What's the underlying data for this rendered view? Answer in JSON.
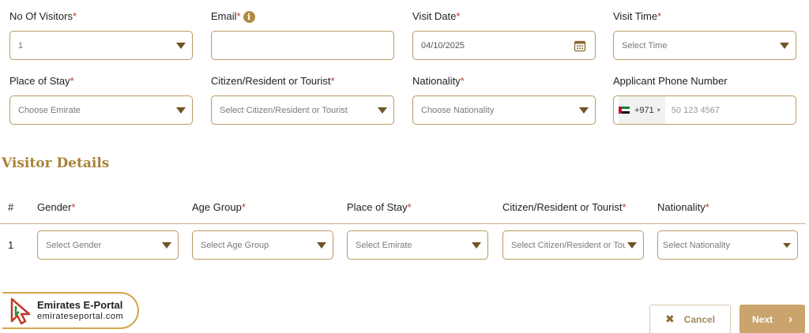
{
  "form": {
    "row1": [
      {
        "label": "No Of Visitors",
        "value": "1",
        "placeholder": ""
      },
      {
        "label": "Email",
        "value": "",
        "placeholder": ""
      },
      {
        "label": "Visit Date",
        "value": "04/10/2025",
        "placeholder": ""
      },
      {
        "label": "Visit Time",
        "value": "",
        "placeholder": "Select Time"
      }
    ],
    "row2": [
      {
        "label": "Place of Stay",
        "placeholder": "Choose Emirate"
      },
      {
        "label": "Citizen/Resident or Tourist",
        "placeholder": "Select Citizen/Resident or Tourist"
      },
      {
        "label": "Nationality",
        "placeholder": "Choose Nationality"
      },
      {
        "label": "Applicant Phone Number",
        "country_code": "+971",
        "placeholder": "50 123 4567"
      }
    ],
    "required_mark": "*",
    "email_info_icon": "i"
  },
  "visitor_details": {
    "title": "Visitor Details",
    "columns": [
      "#",
      "Gender",
      "Age Group",
      "Place of Stay",
      "Citizen/Resident or Tourist",
      "Nationality"
    ],
    "rows": [
      {
        "index": "1",
        "gender": "Select Gender",
        "age_group": "Select Age Group",
        "place_of_stay": "Select Emirate",
        "citizen": "Select Citizen/Resident or Tourist",
        "nationality": "Select Nationality"
      }
    ]
  },
  "actions": {
    "cancel_label": "Cancel",
    "next_label": "Next"
  },
  "watermark": {
    "name": "Emirates E-Portal",
    "site": "emirateseportal.com"
  },
  "colors": {
    "accent": "#b89963",
    "heading": "#a88238",
    "required": "#c0392b",
    "next_button": "#c9a46d"
  },
  "icons": [
    "info-icon",
    "calendar-icon",
    "chevron-down-icon",
    "uae-flag-icon",
    "close-icon",
    "chevron-right-icon",
    "cursor-logo-icon"
  ]
}
